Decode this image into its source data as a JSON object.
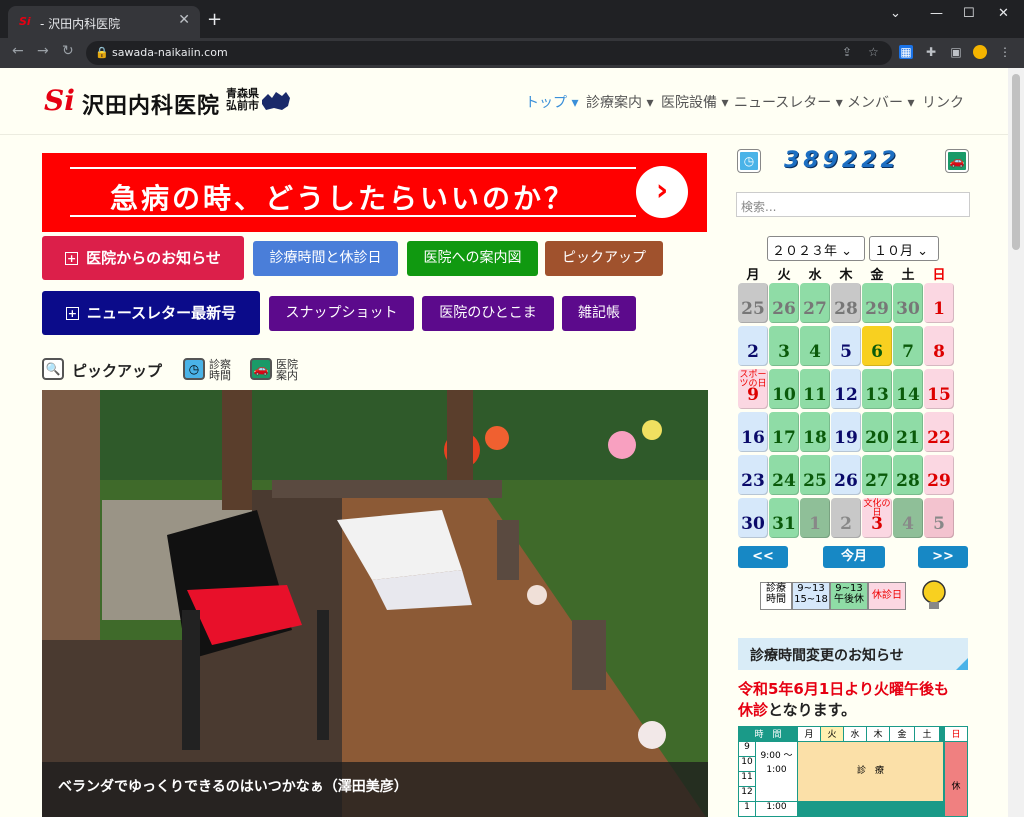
{
  "browser": {
    "tab_title": "- 沢田内科医院",
    "url": "sawada-naikaiin.com"
  },
  "site": {
    "logo_mark": "Si",
    "logo_name": "沢田内科医院",
    "logo_pref": "青森県 弘前市"
  },
  "menu": [
    "トップ",
    "診療案内",
    "医院設備",
    "ニュースレター",
    "メンバー",
    "リンク"
  ],
  "banner": {
    "text": "急病の時、どうしたらいいのか？",
    "arrow": "›"
  },
  "buttons": {
    "notice": "医院からのお知らせ",
    "hours": "診療時間と休診日",
    "map": "医院への案内図",
    "pickup": "ピックアップ",
    "newsletter": "ニュースレター最新号",
    "snapshot": "スナップショット",
    "scene": "医院のひとこま",
    "notes": "雑記帳"
  },
  "section": {
    "title": "ピックアップ",
    "icon1": "診察 時間",
    "icon2": "医院 案内"
  },
  "photo": {
    "caption": "ベランダでゆっくりできるのはいつかなぁ（澤田美彦）"
  },
  "counter": {
    "value": "389222"
  },
  "search": {
    "placeholder": "検索..."
  },
  "calendar": {
    "year": "２０２３年",
    "month": "１０月",
    "weekdays": [
      "月",
      "火",
      "水",
      "木",
      "金",
      "土",
      "日"
    ],
    "prev": "<<",
    "today": "今月",
    "next": ">>",
    "holidays": {
      "sports": "スポーツの日",
      "culture": "文化の日"
    },
    "days": [
      [
        "25",
        "26",
        "27",
        "28",
        "29",
        "30",
        "1"
      ],
      [
        "2",
        "3",
        "4",
        "5",
        "6",
        "7",
        "8"
      ],
      [
        "9",
        "10",
        "11",
        "12",
        "13",
        "14",
        "15"
      ],
      [
        "16",
        "17",
        "18",
        "19",
        "20",
        "21",
        "22"
      ],
      [
        "23",
        "24",
        "25",
        "26",
        "27",
        "28",
        "29"
      ],
      [
        "30",
        "31",
        "1",
        "2",
        "3",
        "4",
        "5"
      ]
    ]
  },
  "legend": {
    "label": "診療 時間",
    "a": "9~13 15~18",
    "b": "9~13 午後休",
    "c": "休診日"
  },
  "notice": {
    "title": "診療時間変更のお知らせ",
    "line1": "令和5年6月1日より火曜午後も",
    "line2a": "休診",
    "line2b": "となります。"
  },
  "schedule": {
    "head": [
      "時　間",
      "月",
      "火",
      "水",
      "木",
      "金",
      "土",
      "日"
    ],
    "rows": [
      "9",
      "10",
      "11",
      "12",
      "1"
    ],
    "time": "9:00 〜 1:00",
    "time2": "1:00",
    "mid": "診　療",
    "closed": "休"
  },
  "colors": {
    "accent": "#e60012",
    "menu_active": "#3a8fd9",
    "calendar_green": "#8fdca6"
  }
}
